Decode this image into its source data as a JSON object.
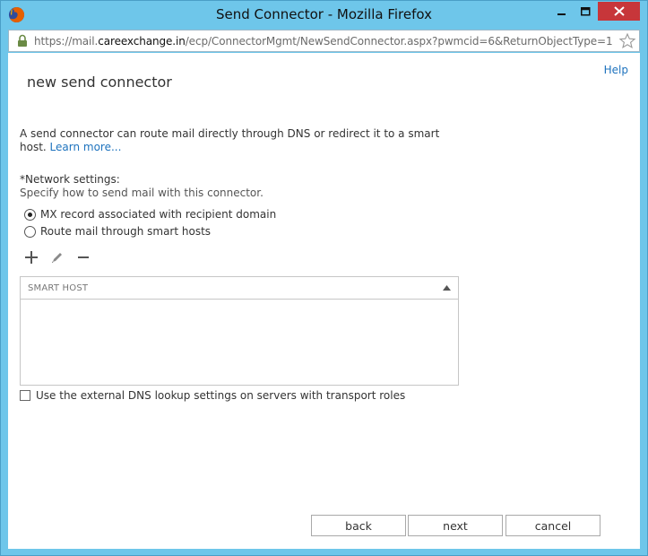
{
  "window": {
    "title": "Send Connector - Mozilla Firefox",
    "controls": {
      "minimize": "minimize-icon",
      "maximize": "maximize-icon",
      "close": "close-icon"
    },
    "close_color": "#c7363a",
    "frame_color": "#6ec6ea"
  },
  "address": {
    "prefix": "https://mail.",
    "host": "careexchange.in",
    "path": "/ecp/ConnectorMgmt/NewSendConnector.aspx?pwmcid=6&ReturnObjectType=1"
  },
  "page": {
    "help": "Help",
    "title": "new send connector",
    "intro_text": "A send connector can route mail directly through DNS or redirect it to a smart host.",
    "learn_more": "Learn more...",
    "network_label": "*Network settings:",
    "network_desc": "Specify how to send mail with this connector.",
    "radio_options": [
      {
        "label": "MX record associated with recipient domain",
        "selected": true
      },
      {
        "label": "Route mail through smart hosts",
        "selected": false
      }
    ],
    "toolbar": {
      "add": "add-icon",
      "edit": "edit-icon",
      "remove": "remove-icon"
    },
    "grid_header": "SMART HOST",
    "external_dns_label": "Use the external DNS lookup settings on servers with transport roles",
    "external_dns_checked": false,
    "buttons": {
      "back": "back",
      "next": "next",
      "cancel": "cancel"
    },
    "link_color": "#1e73be"
  }
}
